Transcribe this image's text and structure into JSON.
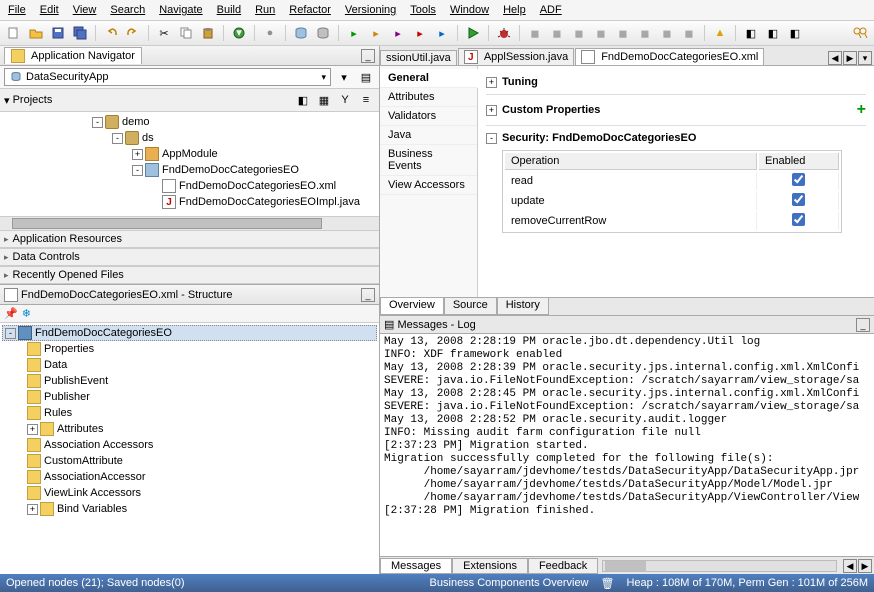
{
  "menu": [
    "File",
    "Edit",
    "View",
    "Search",
    "Navigate",
    "Build",
    "Run",
    "Refactor",
    "Versioning",
    "Tools",
    "Window",
    "Help",
    "ADF"
  ],
  "app_nav": {
    "tab": "Application Navigator",
    "project": "DataSecurityApp",
    "section": "Projects"
  },
  "tree": {
    "demo": "demo",
    "ds": "ds",
    "appmod": "AppModule",
    "eo": "FndDemoDocCategoriesEO",
    "eoxml": "FndDemoDocCategoriesEO.xml",
    "eoimpl": "FndDemoDocCategoriesEOImpl.java"
  },
  "accordion": [
    "Application Resources",
    "Data Controls",
    "Recently Opened Files"
  ],
  "structure": {
    "title": "FndDemoDocCategoriesEO.xml - Structure",
    "root": "FndDemoDocCategoriesEO",
    "items": [
      "Properties",
      "Data",
      "PublishEvent",
      "Publisher",
      "Rules",
      "Attributes",
      "Association Accessors",
      "CustomAttribute",
      "AssociationAccessor",
      "ViewLink Accessors",
      "Bind Variables"
    ]
  },
  "editor": {
    "tabs": [
      "ssionUtil.java",
      "ApplSession.java",
      "FndDemoDocCategoriesEO.xml"
    ],
    "side": [
      "General",
      "Attributes",
      "Validators",
      "Java",
      "Business Events",
      "View Accessors"
    ],
    "tuning": "Tuning",
    "custom": "Custom Properties",
    "security": "Security: FndDemoDocCategoriesEO",
    "cols": [
      "Operation",
      "Enabled"
    ],
    "rows": [
      "read",
      "update",
      "removeCurrentRow"
    ],
    "views": [
      "Overview",
      "Source",
      "History"
    ]
  },
  "messages": {
    "title": "Messages - Log",
    "lines": [
      "May 13, 2008 2:28:19 PM oracle.jbo.dt.dependency.Util log",
      "INFO: XDF framework enabled",
      "May 13, 2008 2:28:39 PM oracle.security.jps.internal.config.xml.XmlConfi",
      "SEVERE: java.io.FileNotFoundException: /scratch/sayarram/view_storage/sa",
      "May 13, 2008 2:28:45 PM oracle.security.jps.internal.config.xml.XmlConfi",
      "SEVERE: java.io.FileNotFoundException: /scratch/sayarram/view_storage/sa",
      "May 13, 2008 2:28:52 PM oracle.security.audit.logger",
      "INFO: Missing audit farm configuration file null",
      "[2:37:23 PM] Migration started.",
      "Migration successfully completed for the following file(s):",
      "      /home/sayarram/jdevhome/testds/DataSecurityApp/DataSecurityApp.jpr",
      "      /home/sayarram/jdevhome/testds/DataSecurityApp/Model/Model.jpr",
      "      /home/sayarram/jdevhome/testds/DataSecurityApp/ViewController/View",
      "[2:37:28 PM] Migration finished."
    ],
    "tabs": [
      "Messages",
      "Extensions",
      "Feedback"
    ]
  },
  "status": {
    "left": "Opened nodes (21); Saved nodes(0)",
    "mid": "Business Components Overview",
    "heap": "Heap : 108M of 170M, Perm Gen : 101M of 256M"
  }
}
